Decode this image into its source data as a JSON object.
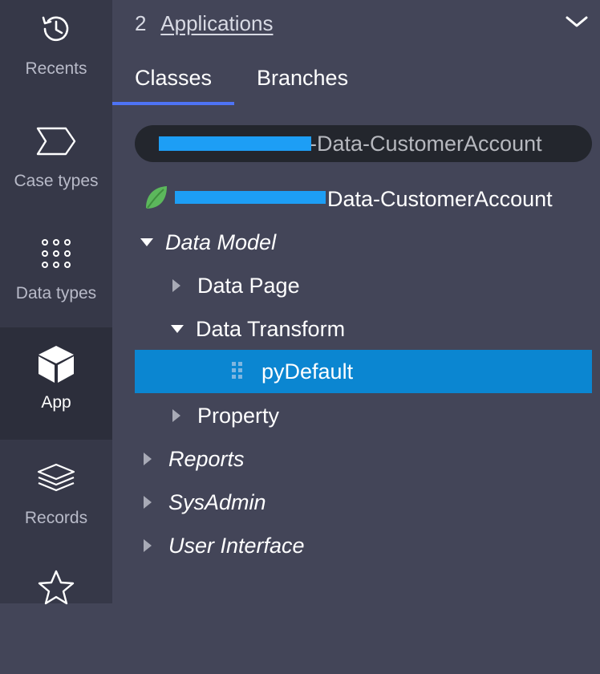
{
  "rail": {
    "items": [
      {
        "label": "Recents",
        "icon": "history-icon"
      },
      {
        "label": "Case types",
        "icon": "case-type-icon"
      },
      {
        "label": "Data types",
        "icon": "grid-dots-icon"
      },
      {
        "label": "App",
        "icon": "cube-icon",
        "active": true
      },
      {
        "label": "Records",
        "icon": "layers-icon"
      },
      {
        "label": "",
        "icon": "star-icon"
      }
    ]
  },
  "header": {
    "count": "2",
    "applications_link": "Applications"
  },
  "tabs": [
    {
      "label": "Classes",
      "active": true
    },
    {
      "label": "Branches",
      "active": false
    }
  ],
  "class_search": {
    "value_suffix": "-Data-CustomerAccount"
  },
  "class_row": {
    "label_suffix": "Data-CustomerAccount"
  },
  "tree": {
    "data_model": "Data Model",
    "data_page": "Data Page",
    "data_transform": "Data Transform",
    "selected_item": "pyDefault",
    "property": "Property",
    "reports": "Reports",
    "sysadmin": "SysAdmin",
    "user_interface": "User Interface"
  },
  "colors": {
    "accent": "#4e73f5",
    "selection": "#0b86d1",
    "redaction": "#1d9ef5",
    "leaf_green": "#5cb85c"
  }
}
